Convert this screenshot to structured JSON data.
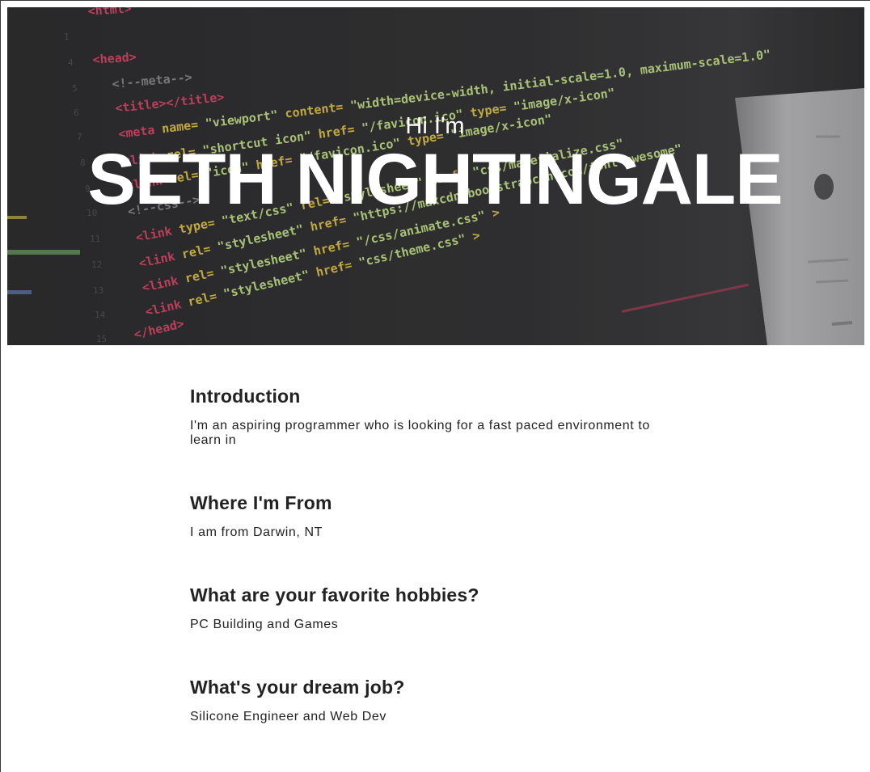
{
  "hero": {
    "greeting": "Hi I'm",
    "name": "SETH NIGHTINGALE"
  },
  "sections": [
    {
      "heading": "Introduction",
      "text": "I'm an aspiring programmer who is looking for a fast paced environment to learn in"
    },
    {
      "heading": "Where I'm From",
      "text": "I am from Darwin, NT"
    },
    {
      "heading": "What are your favorite hobbies?",
      "text": "PC Building and Games"
    },
    {
      "heading": "What's your dream job?",
      "text": "Silicone Engineer and Web Dev"
    }
  ],
  "colors": {
    "hero_background": "#2f2f31",
    "text": "#222222",
    "hero_text": "#ffffff"
  }
}
